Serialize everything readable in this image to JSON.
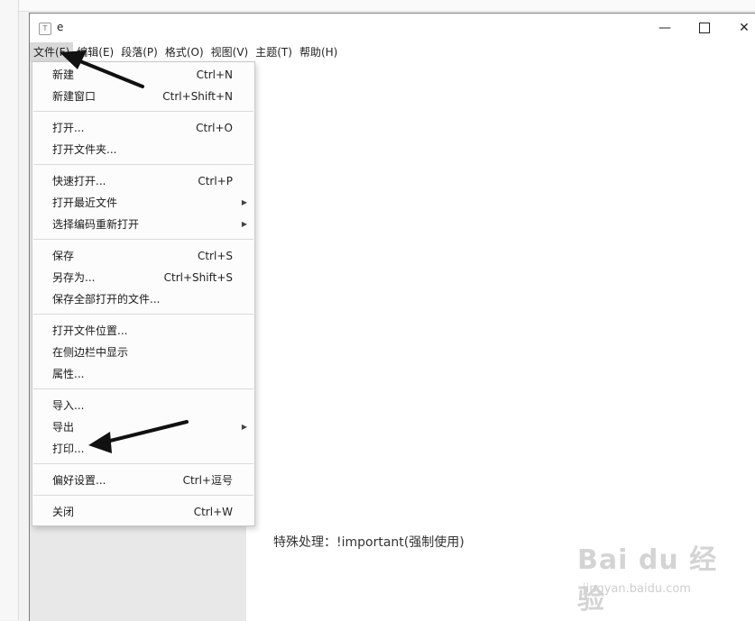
{
  "window": {
    "title": "e",
    "app_icon": "T",
    "close_glyph": "✕",
    "minimize_glyph": "—"
  },
  "menubar": [
    "文件(F)",
    "编辑(E)",
    "段落(P)",
    "格式(O)",
    "视图(V)",
    "主题(T)",
    "帮助(H)"
  ],
  "file_menu": {
    "items": [
      {
        "label": "新建",
        "shortcut": "Ctrl+N",
        "submenu": false
      },
      {
        "label": "新建窗口",
        "shortcut": "Ctrl+Shift+N",
        "submenu": false
      },
      {
        "label": "打开...",
        "shortcut": "Ctrl+O",
        "submenu": false
      },
      {
        "label": "打开文件夹...",
        "shortcut": "",
        "submenu": false
      },
      {
        "label": "快速打开...",
        "shortcut": "Ctrl+P",
        "submenu": false
      },
      {
        "label": "打开最近文件",
        "shortcut": "",
        "submenu": true
      },
      {
        "label": "选择编码重新打开",
        "shortcut": "",
        "submenu": true
      },
      {
        "label": "保存",
        "shortcut": "Ctrl+S",
        "submenu": false
      },
      {
        "label": "另存为...",
        "shortcut": "Ctrl+Shift+S",
        "submenu": false
      },
      {
        "label": "保存全部打开的文件...",
        "shortcut": "",
        "submenu": false
      },
      {
        "label": "打开文件位置...",
        "shortcut": "",
        "submenu": false
      },
      {
        "label": "在侧边栏中显示",
        "shortcut": "",
        "submenu": false
      },
      {
        "label": "属性...",
        "shortcut": "",
        "submenu": false
      },
      {
        "label": "导入...",
        "shortcut": "",
        "submenu": false
      },
      {
        "label": "导出",
        "shortcut": "",
        "submenu": true
      },
      {
        "label": "打印...",
        "shortcut": "",
        "submenu": false
      },
      {
        "label": "偏好设置...",
        "shortcut": "Ctrl+逗号",
        "submenu": false
      },
      {
        "label": "关闭",
        "shortcut": "Ctrl+W",
        "submenu": false
      }
    ]
  },
  "editor": {
    "text": "特殊处理：!important(强制使用)"
  },
  "watermark": {
    "text": "Bai du 经验",
    "sub": "jingyan.baidu.com"
  },
  "colors": {
    "arrow": "#111111",
    "menu_active": "#d8d8d8"
  }
}
